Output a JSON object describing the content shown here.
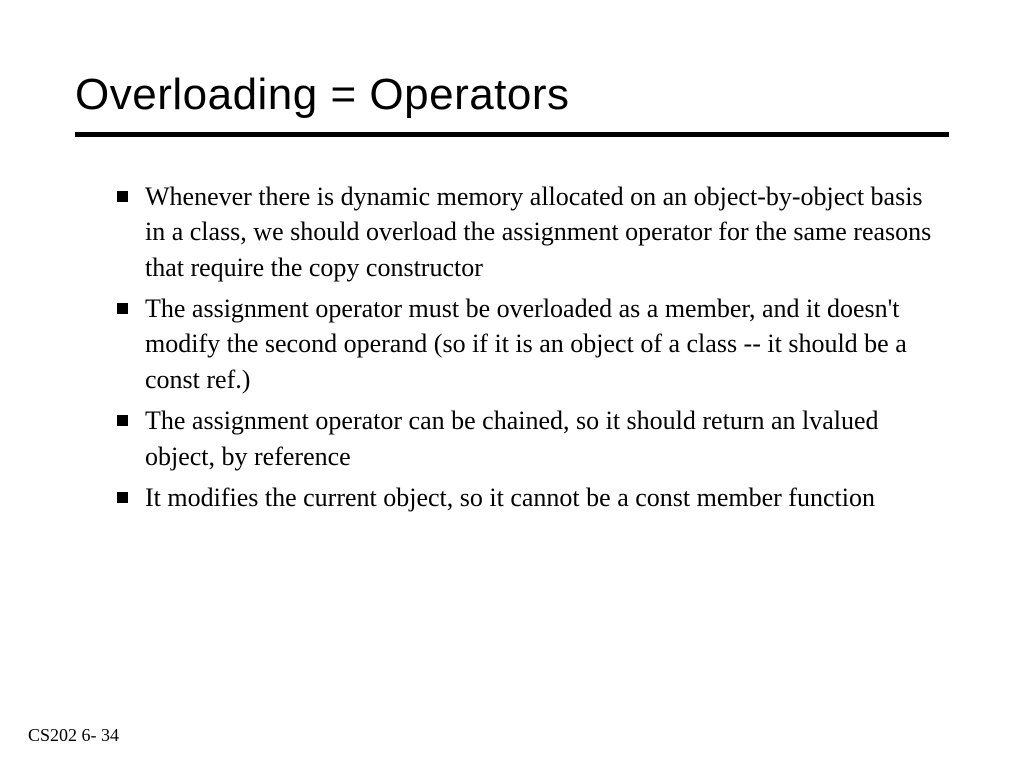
{
  "slide": {
    "title": "Overloading = Operators",
    "bullets": [
      "Whenever there is dynamic memory allocated on an object-by-object basis in a class, we should overload the assignment operator for the same reasons that require the copy constructor",
      "The assignment operator must be overloaded as a member, and it doesn't modify the second operand (so if it is an object of a class -- it should be a const ref.)",
      "The assignment operator can be chained, so it should return an lvalued object, by reference",
      "It modifies the current object, so it cannot be a const member function"
    ],
    "footer": "CS202 6- 34"
  }
}
